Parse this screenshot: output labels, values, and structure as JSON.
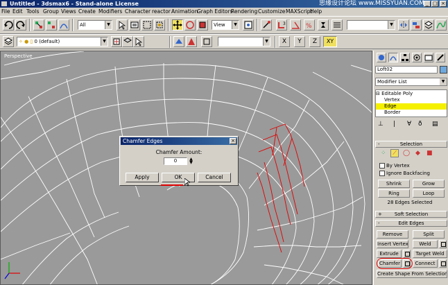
{
  "window": {
    "title": "Untitled - 3dsmax6 - Stand-alone License",
    "watermark": "思缘设计论坛 www.MISSYUAN.COM"
  },
  "menu": [
    "File",
    "Edit",
    "Tools",
    "Group",
    "Views",
    "Create",
    "Modifiers",
    "Character",
    "reactor",
    "Animation",
    "Graph Editors",
    "Rendering",
    "Customize",
    "MAXScript",
    "Help"
  ],
  "toolbar": {
    "selection_filter": "All",
    "ref_coord": "View",
    "named_selection": ""
  },
  "layer_toolbar": {
    "layer_name": "0 (default)",
    "axis_x": "X",
    "axis_y": "Y",
    "axis_xy": "XY"
  },
  "viewport": {
    "label": "Perspective"
  },
  "dialog": {
    "title": "Chamfer Edges",
    "amount_label": "Chamfer Amount:",
    "amount_value": "0",
    "apply_label": "Apply",
    "ok_label": "OK",
    "cancel_label": "Cancel"
  },
  "command_panel": {
    "object_name": "Loft02",
    "object_color": "#6fa8dc",
    "modifier_list": "Modifier List",
    "stack": [
      "Editable Poly",
      "Vertex",
      "Edge",
      "Border"
    ],
    "selection_title": "Selection",
    "by_vertex": "By Vertex",
    "ignore_backfacing": "Ignore Backfacing",
    "shrink": "Shrink",
    "grow": "Grow",
    "ring": "Ring",
    "loop": "Loop",
    "selected_status": "28 Edges Selected",
    "soft_selection_title": "Soft Selection",
    "edit_edges_title": "Edit Edges",
    "remove": "Remove",
    "split": "Split",
    "insert_vertex": "Insert Vertex",
    "weld": "Weld",
    "extrude": "Extrude",
    "target_weld": "Target Weld",
    "chamfer": "Chamfer",
    "connect": "Connect",
    "create_shape": "Create Shape From Selection"
  }
}
